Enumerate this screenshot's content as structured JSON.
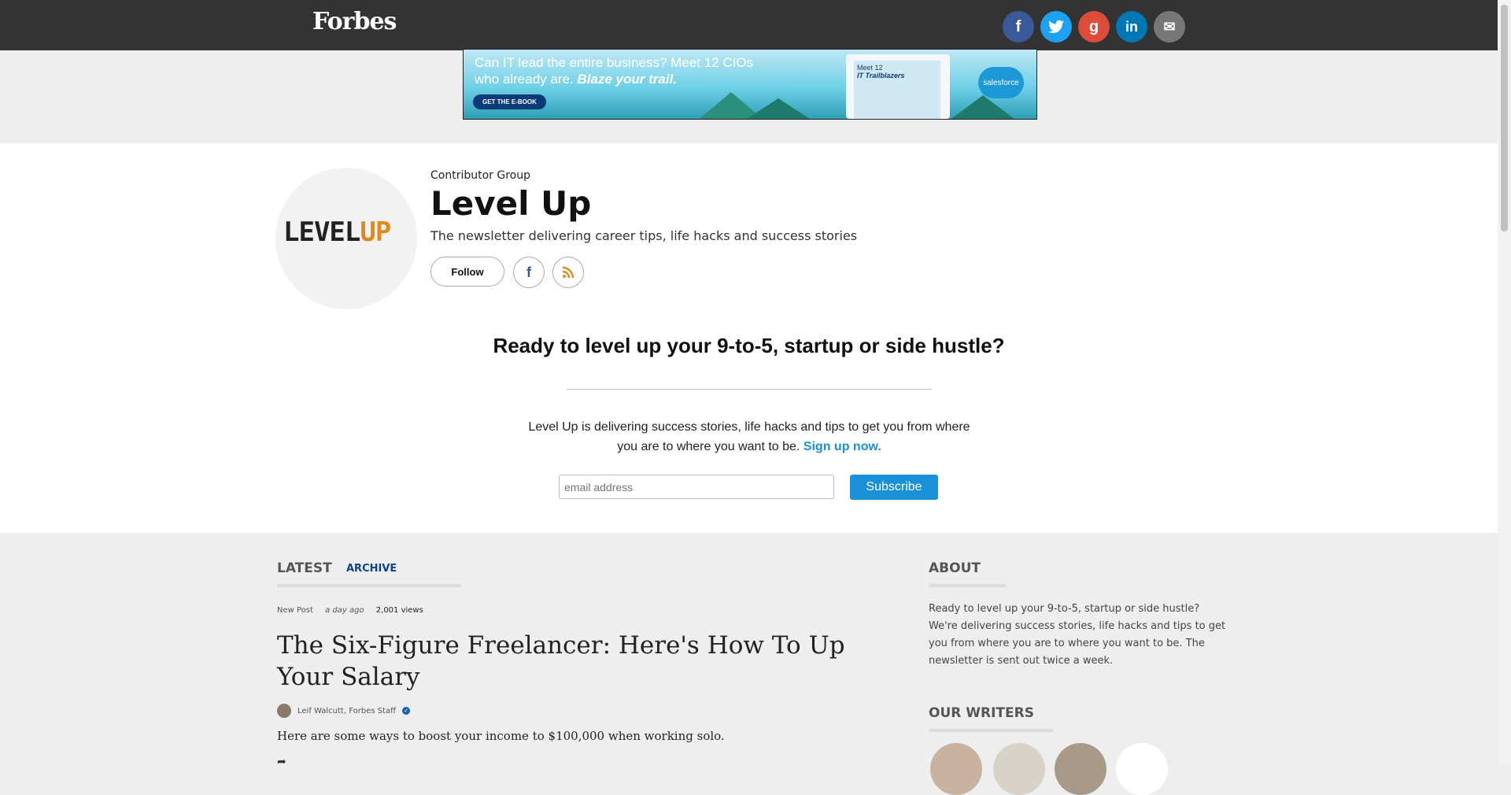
{
  "topbar": {
    "logo": "Forbes",
    "social": [
      {
        "icon": "facebook-icon",
        "glyph": "f",
        "color": "#3b5998"
      },
      {
        "icon": "twitter-icon",
        "glyph": "t",
        "color": "#1da1f2"
      },
      {
        "icon": "google-plus-icon",
        "glyph": "g",
        "color": "#dd4b39"
      },
      {
        "icon": "linkedin-icon",
        "glyph": "in",
        "color": "#0077b5"
      },
      {
        "icon": "email-icon",
        "glyph": "✉",
        "color": "#777777"
      }
    ]
  },
  "ad": {
    "line1": "Can IT lead the entire business? Meet 12 CIOs",
    "line2": "who already are.",
    "emph": "Blaze your trail.",
    "button": "GET THE E-BOOK",
    "book_title": "Meet 12",
    "book_sub": "IT Trailblazers",
    "brand": "salesforce"
  },
  "profile": {
    "avatar_left": "LEVEL",
    "avatar_right": "UP",
    "group_label": "Contributor Group",
    "name": "Level Up",
    "tagline": "The newsletter delivering career tips, life hacks and success stories",
    "follow_label": "Follow"
  },
  "promo": {
    "headline": "Ready to level up your 9-to-5, startup or side hustle?",
    "body": "Level Up is delivering success stories, life hacks and tips to get you from where you are to where you want to be.",
    "link": "Sign up now.",
    "email_placeholder": "email address",
    "subscribe_label": "Subscribe"
  },
  "content": {
    "tab_latest": "LATEST",
    "tab_archive": "ARCHIVE",
    "post": {
      "type": "New Post",
      "time": "a day ago",
      "views": "2,001 views",
      "title": "The Six-Figure Freelancer: Here's How To Up Your Salary",
      "author": "Leif Walcutt, Forbes Staff",
      "excerpt": "Here are some ways to boost your income to $100,000 when working solo."
    }
  },
  "sidebar": {
    "about_heading": "ABOUT",
    "about_text": "Ready to level up your 9-to-5, startup or side hustle? We're delivering success stories, life hacks and tips to get you from where you are to where you want to be. The newsletter is sent out twice a week.",
    "writers_heading": "OUR WRITERS"
  }
}
